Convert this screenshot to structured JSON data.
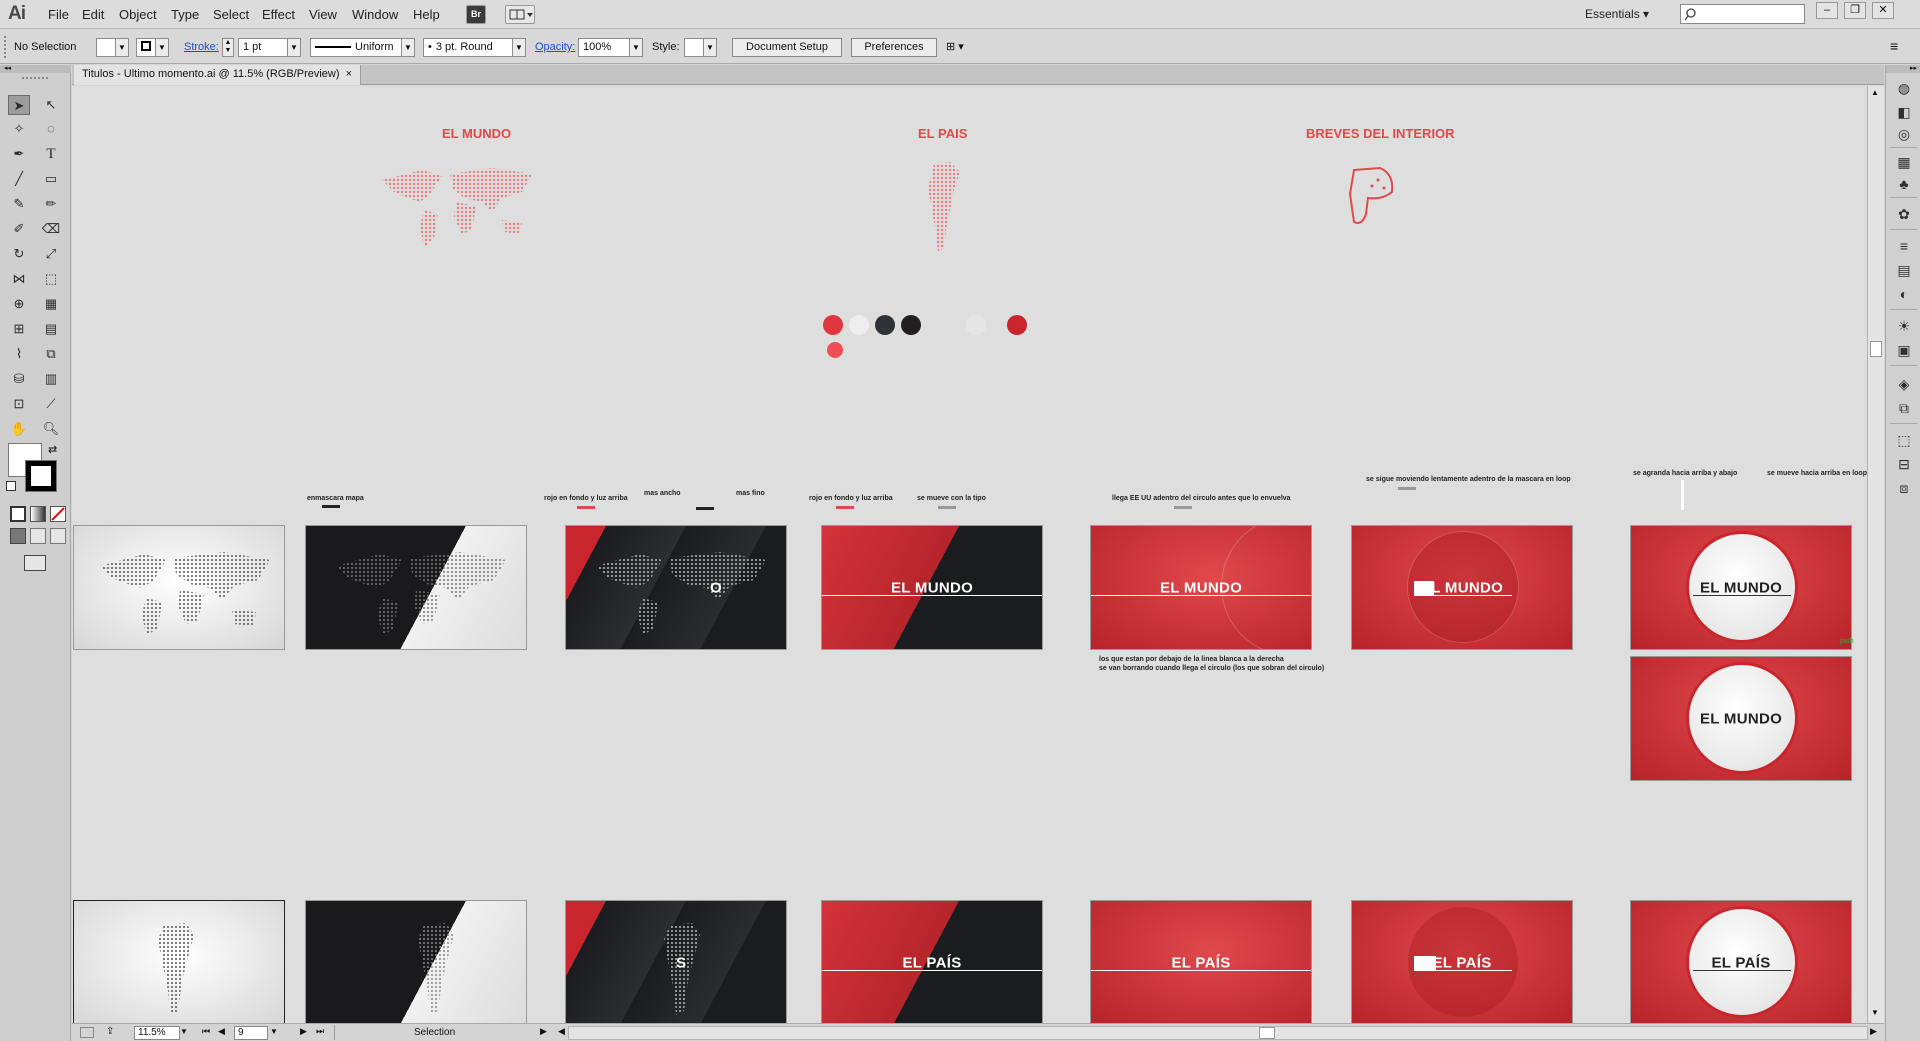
{
  "app": {
    "logo": "Ai"
  },
  "menu": [
    "File",
    "Edit",
    "Object",
    "Type",
    "Select",
    "Effect",
    "View",
    "Window",
    "Help"
  ],
  "menu_icons": {
    "bridge": "Br"
  },
  "workspace": {
    "label": "Essentials",
    "search_placeholder": ""
  },
  "control": {
    "selection": "No Selection",
    "stroke_label": "Stroke:",
    "stroke_value": "1 pt",
    "profile": "Uniform",
    "brush": "3 pt. Round",
    "opacity_label": "Opacity:",
    "opacity_value": "100%",
    "style_label": "Style:",
    "doc_setup": "Document Setup",
    "preferences": "Preferences"
  },
  "document": {
    "tab_title": "Titulos - Ultimo momento.ai @ 11.5% (RGB/Preview)",
    "close": "×"
  },
  "artboards": {
    "top_labels": [
      "EL MUNDO",
      "EL PAIS",
      "BREVES DEL INTERIOR"
    ],
    "swatch_colors": [
      "#e0373d",
      "#eeeeee",
      "#2f3238",
      "#231f20",
      "#e6e6e6",
      "#c8262c",
      "#ef4f52"
    ],
    "row1_title": "EL MUNDO",
    "row1_partial": "O",
    "row3_title": "EL PAÍS",
    "row3_partial": "S",
    "notes": {
      "n1": "enmascara mapa",
      "n2": "rojo en fondo y luz arriba",
      "n3": "mas ancho",
      "n4": "mas fino",
      "n5": "rojo en fondo y luz arriba",
      "n6": "se mueve con la tipo",
      "n7": "llega EE UU adentro del circulo antes que lo envuelva",
      "n8": "se sigue moviendo lentamente adentro de la mascara en loop",
      "n9": "se agranda hacia arriba y abajo",
      "n10": "se mueve hacia arriba en loop",
      "n11": "los que estan por debajo de la linea blanca a la derecha",
      "n12": "se van borrando cuando llega el circulo (los que sobran del circulo)",
      "n13": "path"
    }
  },
  "status": {
    "zoom": "11.5%",
    "artboard": "9",
    "tool": "Selection"
  }
}
